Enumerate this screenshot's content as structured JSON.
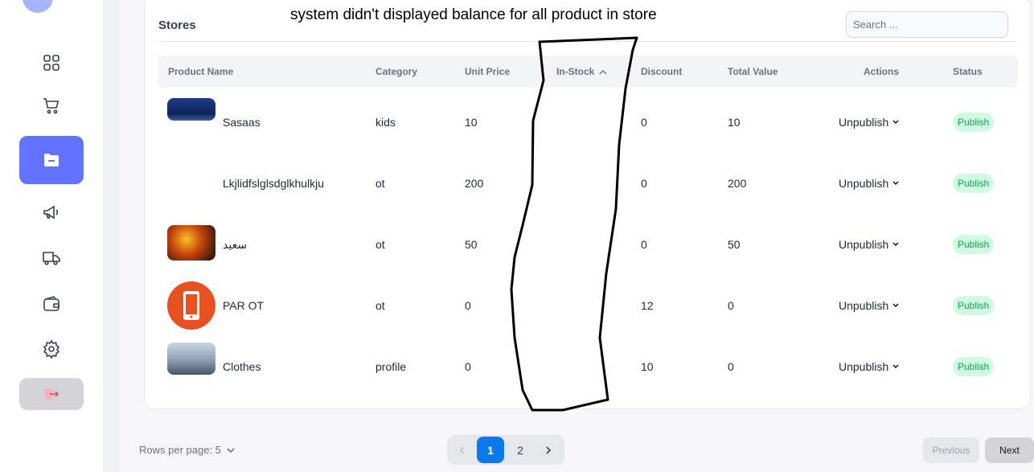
{
  "annotation": "system didn't displayed balance for all product in store",
  "card": {
    "title": "Stores",
    "search_placeholder": "Search ..."
  },
  "columns": [
    "Product Name",
    "Category",
    "Unit Price",
    "In-Stock",
    "Discount",
    "Total Value",
    "Actions",
    "Status"
  ],
  "rows": [
    {
      "name": "Sasaas",
      "category": "kids",
      "unit_price": "10",
      "in_stock": "",
      "discount": "0",
      "total_value": "10",
      "action": "Unpublish",
      "status": "Publish"
    },
    {
      "name": "Lkjlidfslglsdglkhulkju",
      "category": "ot",
      "unit_price": "200",
      "in_stock": "",
      "discount": "0",
      "total_value": "200",
      "action": "Unpublish",
      "status": "Publish"
    },
    {
      "name": "سعيد",
      "category": "ot",
      "unit_price": "50",
      "in_stock": "",
      "discount": "0",
      "total_value": "50",
      "action": "Unpublish",
      "status": "Publish"
    },
    {
      "name": "PAR OT",
      "category": "ot",
      "unit_price": "0",
      "in_stock": "",
      "discount": "12",
      "total_value": "0",
      "action": "Unpublish",
      "status": "Publish"
    },
    {
      "name": "Clothes",
      "category": "profile",
      "unit_price": "0",
      "in_stock": "",
      "discount": "10",
      "total_value": "0",
      "action": "Unpublish",
      "status": "Publish"
    }
  ],
  "footer": {
    "rows_per_page": "Rows per page: 5",
    "pages": [
      "1",
      "2"
    ],
    "current_page": "1",
    "previous": "Previous",
    "next": "Next"
  },
  "colors": {
    "accent": "#6173ff",
    "page_active": "#0a78f0",
    "badge_bg": "#d1fae5",
    "badge_text": "#16a34a"
  }
}
